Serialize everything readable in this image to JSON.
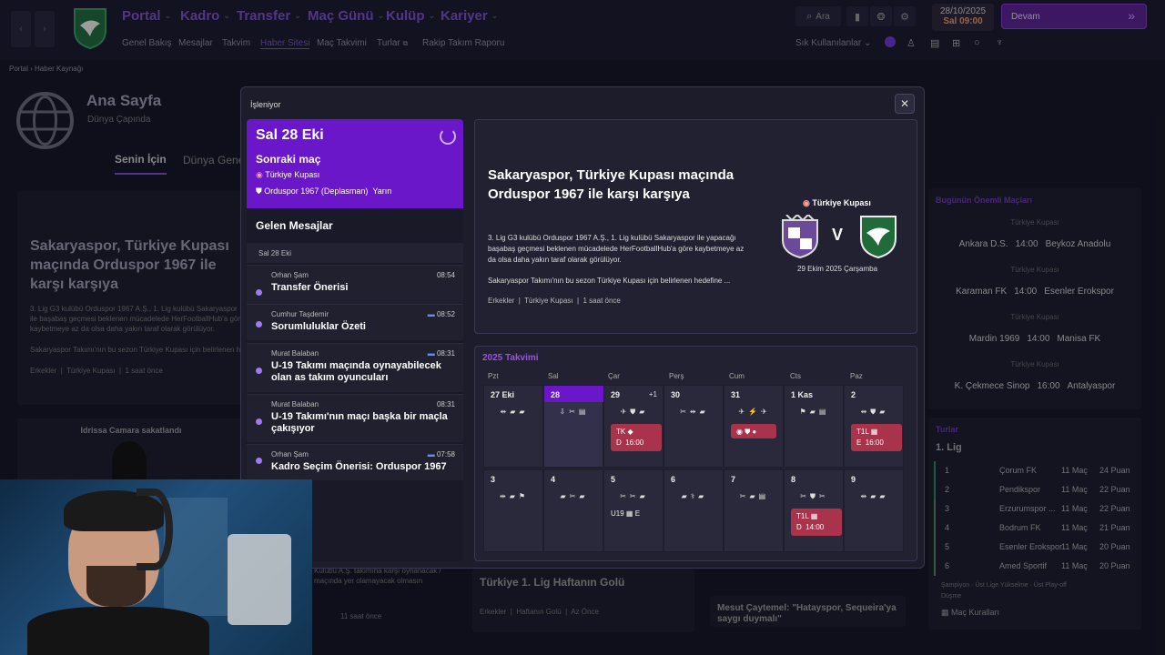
{
  "nav": {
    "menus": [
      "Portal",
      "Kadro",
      "Transfer",
      "Maç Günü",
      "Kulüp",
      "Kariyer"
    ],
    "submenus": [
      "Genel Bakış",
      "Mesajlar",
      "Takvim",
      "Haber Sitesi",
      "Maç Takvimi",
      "Turlar",
      "Rakip Takım Raporu"
    ],
    "search_label": "Ara",
    "date": "28/10/2025",
    "day_time": "Sal 09:00",
    "continue_label": "Devam",
    "favorites_label": "Sık Kullanılanlar"
  },
  "breadcrumb": {
    "root": "Portal",
    "current": "Haber Kaynağı"
  },
  "bg": {
    "title": "Ana Sayfa",
    "subtitle": "Dünya Çapında",
    "tab_for_you": "Senin İçin",
    "tab_world": "Dünya Gene",
    "headline": "Sakaryaspor, Türkiye Kupası maçında Orduspor 1967 ile karşı karşıya",
    "body": "3. Lig G3 kulübü Orduspor 1967 A.Ş., 1. Lig kulübü Sakaryaspor ile başabaş geçmesi beklenen mücadelede HerFootballHub'a göre kaybetmeye az da olsa daha yakın taraf olarak görülüyor.",
    "body2": "Sakaryaspor Takımı'nın bu sezon Türkiye Kupası için belirlenen h",
    "tag1": "Erkekler",
    "tag2": "Türkiye Kupası",
    "ago": "1 saat önce",
    "injury": "Idrissa Camara sakatlandı",
    "goal_title": "Türkiye 1. Lig Haftanın Golü",
    "goal_tag1": "Erkekler",
    "goal_tag2": "Haftanın Golü",
    "goal_ago": "Az Önce",
    "lower_text": "Kulübü A.Ş. takımına karşı oynanacak / maçında yer olamayacak olmasın",
    "lower_ago": "11 saat önce",
    "mesut": "Mesut Çaytemel: \"Hatayspor, Sequeira'ya saygı duymalı\""
  },
  "modal": {
    "title": "İşleniyor",
    "next_date": "Sal 28 Eki",
    "next_label": "Sonraki maç",
    "competition": "Türkiye Kupası",
    "opponent": "Orduspor 1967 (Deplasman)",
    "when": "Yarın",
    "inbox_title": "Gelen Mesajlar",
    "inbox_date": "Sal 28 Eki",
    "messages": [
      {
        "from": "Orhan Şam",
        "time": "08:54",
        "subject": "Transfer Önerisi"
      },
      {
        "from": "Cumhur Taşdemir",
        "time": "08:52",
        "subject": "Sorumluluklar Özeti"
      },
      {
        "from": "Murat Balaban",
        "time": "08:31",
        "subject": "U-19 Takımı maçında oynayabilecek olan as takım oyuncuları"
      },
      {
        "from": "Murat Balaban",
        "time": "08:31",
        "subject": "U-19 Takımı'nın maçı başka bir maçla çakışıyor"
      },
      {
        "from": "Orhan Şam",
        "time": "07:58",
        "subject": "Kadro Seçim Önerisi: Orduspor 1967"
      }
    ],
    "news_headline": "Sakaryaspor, Türkiye Kupası maçında Orduspor 1967 ile karşı karşıya",
    "news_body": "3. Lig G3 kulübü Orduspor 1967 A.Ş., 1. Lig kulübü Sakaryaspor ile yapacağı başabaş geçmesi beklenen mücadelede HerFootballHub'a göre kaybetmeye az da olsa daha yakın taraf olarak görülüyor.",
    "news_body2": "Sakaryaspor Takımı'nın bu sezon Türkiye Kupası için belirlenen hedefine ...",
    "news_tag1": "Erkekler",
    "news_tag2": "Türkiye Kupası",
    "news_ago": "1 saat önce",
    "match_comp": "Türkiye Kupası",
    "vs": "V",
    "match_date": "29 Ekim 2025 Çarşamba",
    "cal_title": "2025 Takvimi",
    "days": [
      "Pzt",
      "Sal",
      "Çar",
      "Perş",
      "Cum",
      "Cts",
      "Paz"
    ],
    "week1": [
      "27 Eki",
      "28",
      "29",
      "30",
      "31",
      "1 Kas",
      "2"
    ],
    "week2": [
      "3",
      "4",
      "5",
      "6",
      "7",
      "8",
      "9"
    ],
    "plus_more": "+1",
    "ev1_team": "TK",
    "ev1_loc": "D",
    "ev1_time": "16:00",
    "ev2_team": "T1L",
    "ev2_loc": "E",
    "ev2_time": "16:00",
    "ev3_team": "U19",
    "ev3_loc": "E",
    "ev4_team": "T1L",
    "ev4_loc": "D",
    "ev4_time": "14:00"
  },
  "right": {
    "title": "Bugünün Önemli Maçları",
    "comp": "Türkiye Kupası",
    "matches": [
      {
        "home": "Ankara D.S.",
        "time": "14:00",
        "away": "Beykoz Anadolu"
      },
      {
        "home": "Karaman FK",
        "time": "14:00",
        "away": "Esenler Erokspor"
      },
      {
        "home": "Mardin 1969",
        "time": "14:00",
        "away": "Manisa FK"
      },
      {
        "home": "K. Çekmece Sinop",
        "time": "16:00",
        "away": "Antalyaspor"
      }
    ],
    "tours": "Turlar",
    "league": "1. Lig",
    "table": [
      {
        "pos": "1",
        "team": "Çorum FK",
        "p": "11 Maç",
        "pts": "24 Puan"
      },
      {
        "pos": "2",
        "team": "Pendikspor",
        "p": "11 Maç",
        "pts": "22 Puan"
      },
      {
        "pos": "3",
        "team": "Erzurumspor ...",
        "p": "11 Maç",
        "pts": "22 Puan"
      },
      {
        "pos": "4",
        "team": "Bodrum FK",
        "p": "11 Maç",
        "pts": "21 Puan"
      },
      {
        "pos": "5",
        "team": "Esenler Erokspor",
        "p": "11 Maç",
        "pts": "20 Puan"
      },
      {
        "pos": "6",
        "team": "Amed Sportif",
        "p": "11 Maç",
        "pts": "20 Puan"
      }
    ],
    "legend": "Şampiyon · Üst Lige Yükselme · Üst Play-off",
    "legend2": "Düşme",
    "rules": "Maç Kuralları"
  }
}
